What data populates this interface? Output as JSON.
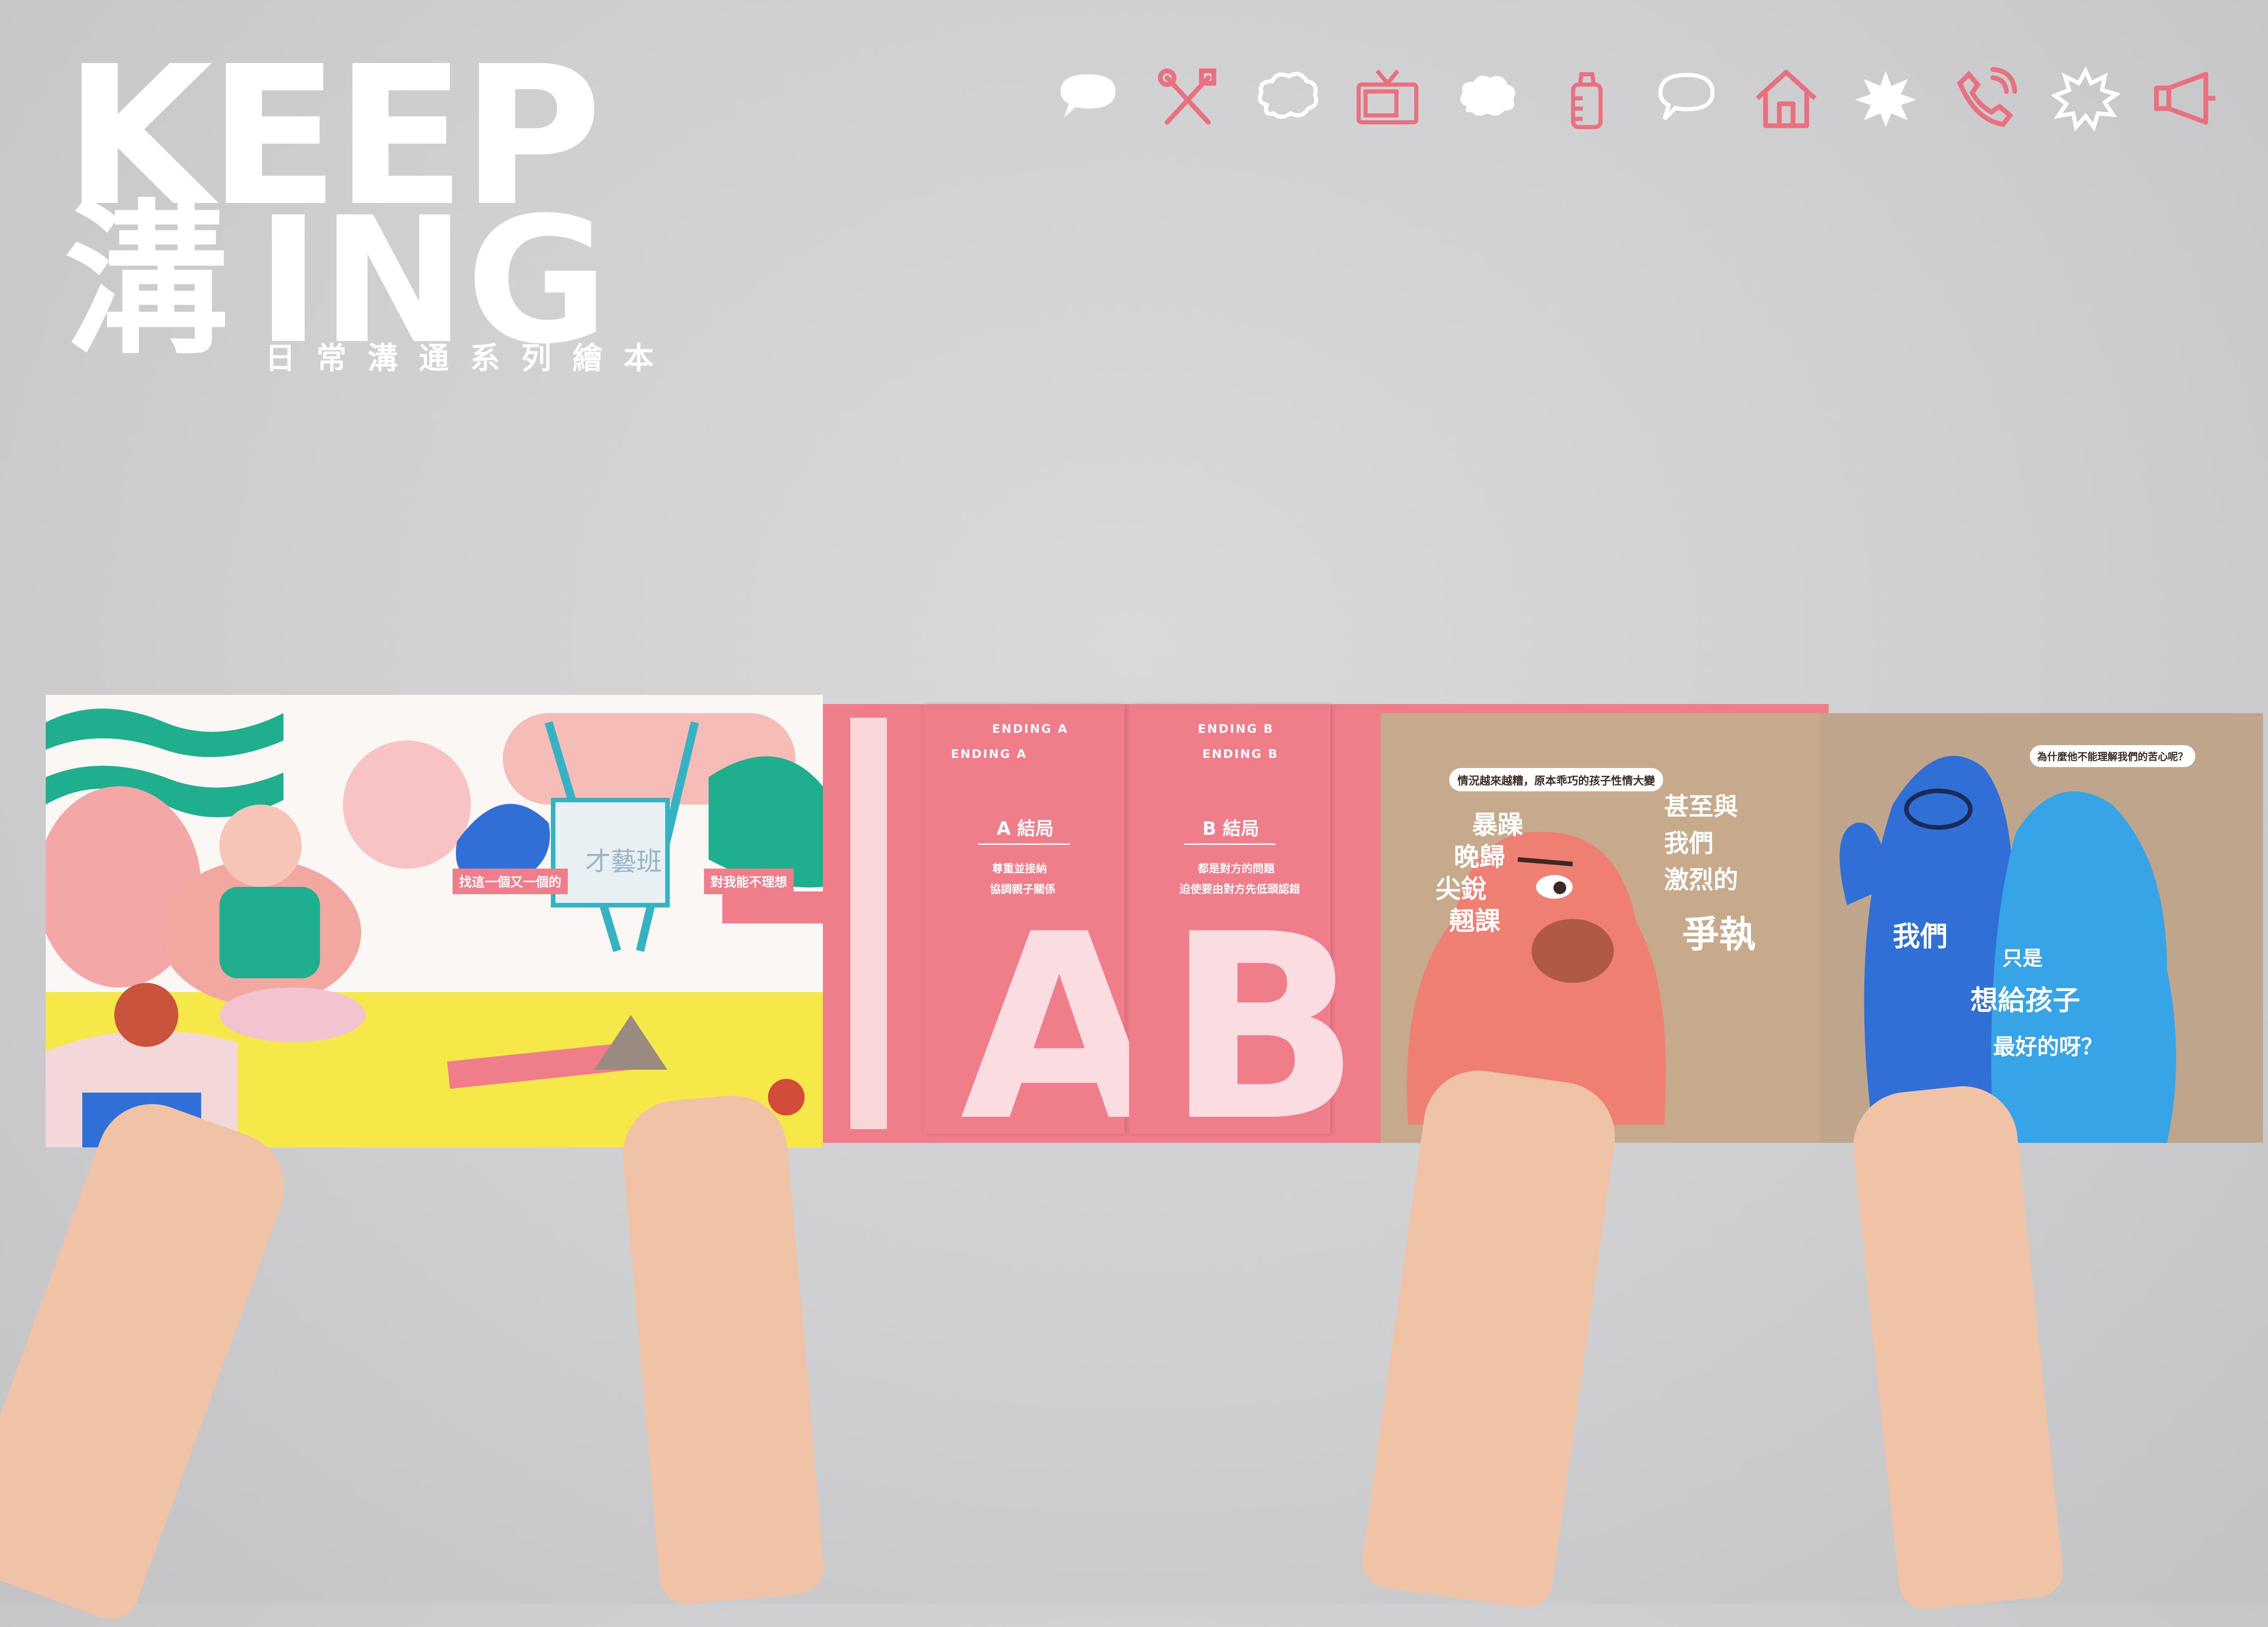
{
  "logo": {
    "keep": "KEEP",
    "han": "溝",
    "ing": "ING",
    "subtitle": "日常溝通系列繪本"
  },
  "icons": [
    "speech-bubble-icon",
    "utensils-icon",
    "cloud-bubble-icon",
    "tv-icon",
    "thought-bubble-icon",
    "baby-bottle-icon",
    "chat-bubble-icon",
    "house-icon",
    "burst-icon",
    "phone-icon",
    "spiky-bubble-icon",
    "megaphone-icon"
  ],
  "colors": {
    "pink": "#f07d8a",
    "white": "#ffffff",
    "blue": "#2f6fd6",
    "background": "#d2d2d4"
  },
  "book": {
    "left_page": {
      "caption_a": "找這一個又一個的",
      "caption_b": "對我能不理想",
      "easel_text": "才藝班"
    },
    "center": {
      "ending_a_banner": "ENDING A",
      "ending_b_banner": "ENDING B",
      "a_title": "A 結局",
      "b_title": "B 結局",
      "a_line1": "尊重並接納",
      "a_line2": "協調親子關係",
      "b_line1": "都是對方的問題",
      "b_line2": "迫使要由對方先低頭認錯",
      "big_a": "A",
      "big_b": "B"
    },
    "right_page": {
      "top_note": "情況越來越糟，原本乖巧的孩子性情大變",
      "left_words": [
        "暴躁",
        "晚歸",
        "尖銳",
        "翹課"
      ],
      "right_words": [
        "甚至與",
        "我們",
        "激烈的",
        "爭執"
      ],
      "blue_note": "為什麼他不能理解我們的苦心呢？",
      "blue_line1": "我們",
      "blue_line2": "只是",
      "blue_line3": "想給孩子",
      "blue_line4": "最好的呀？"
    }
  }
}
